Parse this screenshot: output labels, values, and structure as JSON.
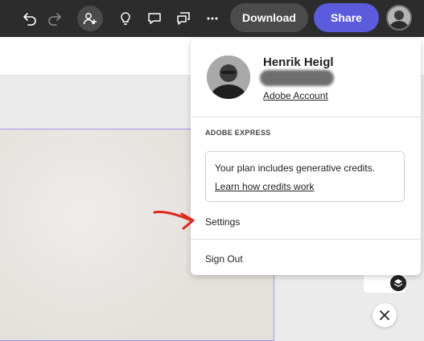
{
  "toolbar": {
    "download_label": "Download",
    "share_label": "Share",
    "icons": [
      "undo-icon",
      "redo-icon",
      "add-person-icon",
      "lightbulb-icon",
      "comment-icon",
      "comments-icon",
      "more-icon"
    ]
  },
  "account_menu": {
    "user_name": "Henrik Heigl",
    "account_link": "Adobe Account",
    "section_title": "ADOBE EXPRESS",
    "credits_text": "Your plan includes generative credits.",
    "credits_link": "Learn how credits work",
    "settings_label": "Settings",
    "sign_out_label": "Sign Out"
  },
  "colors": {
    "topbar": "#2c2c2c",
    "share_button": "#5b5bdc",
    "download_button": "#4b4b4b",
    "annotation_arrow": "#e0281f",
    "canvas_border": "#9e97ef"
  }
}
